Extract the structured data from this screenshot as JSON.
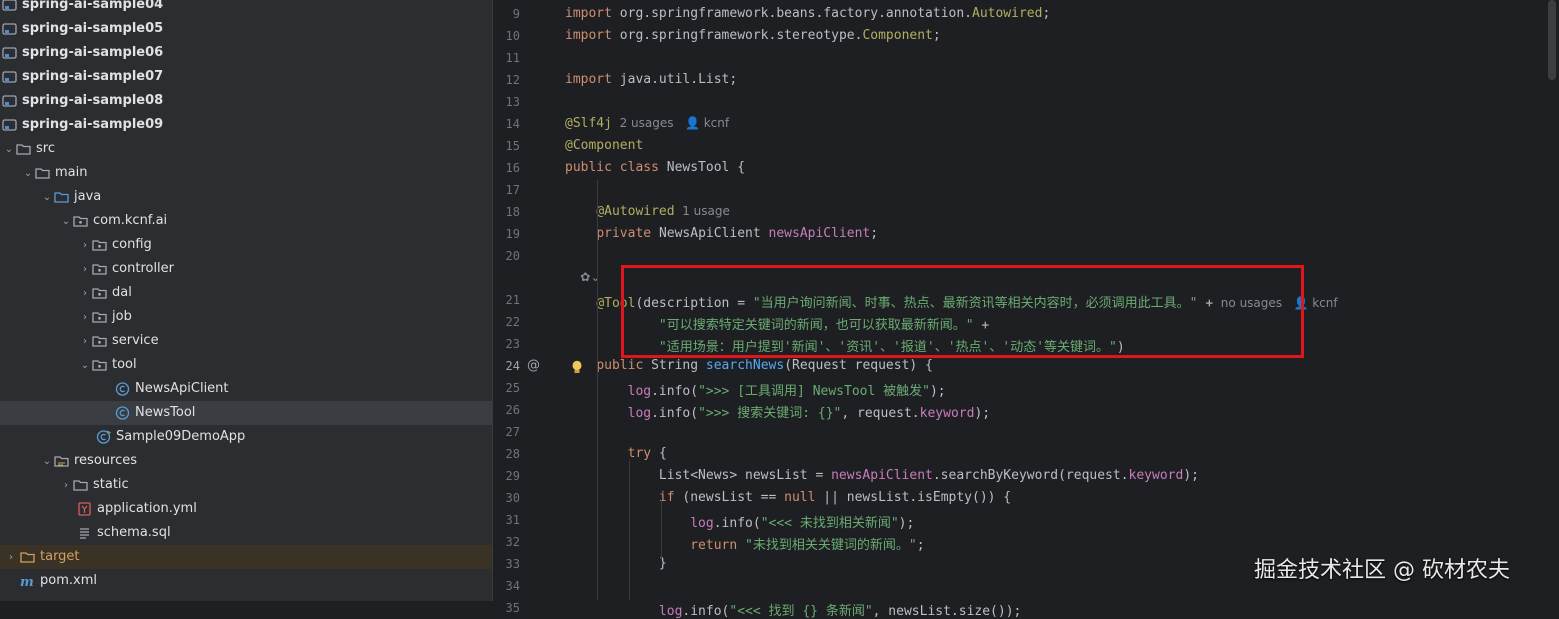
{
  "project_tree": {
    "rows": [
      {
        "label": "spring-ai-sample04",
        "kind": "module",
        "bold": true
      },
      {
        "label": "spring-ai-sample05",
        "kind": "module",
        "bold": true
      },
      {
        "label": "spring-ai-sample06",
        "kind": "module",
        "bold": true
      },
      {
        "label": "spring-ai-sample07",
        "kind": "module",
        "bold": true
      },
      {
        "label": "spring-ai-sample08",
        "kind": "module",
        "bold": true
      },
      {
        "label": "spring-ai-sample09",
        "kind": "module",
        "bold": true
      },
      {
        "label": "src",
        "kind": "folder",
        "indent": 0,
        "arrow": "down"
      },
      {
        "label": "main",
        "kind": "folder",
        "indent": 1,
        "arrow": "down"
      },
      {
        "label": "java",
        "kind": "folder-src",
        "indent": 2,
        "arrow": "down"
      },
      {
        "label": "com.kcnf.ai",
        "kind": "package",
        "indent": 3,
        "arrow": "down"
      },
      {
        "label": "config",
        "kind": "package",
        "indent": 4,
        "arrow": "right"
      },
      {
        "label": "controller",
        "kind": "package",
        "indent": 4,
        "arrow": "right"
      },
      {
        "label": "dal",
        "kind": "package",
        "indent": 4,
        "arrow": "right"
      },
      {
        "label": "job",
        "kind": "package",
        "indent": 4,
        "arrow": "right"
      },
      {
        "label": "service",
        "kind": "package",
        "indent": 4,
        "arrow": "right"
      },
      {
        "label": "tool",
        "kind": "package",
        "indent": 4,
        "arrow": "down"
      },
      {
        "label": "NewsApiClient",
        "kind": "class",
        "indent": 5
      },
      {
        "label": "NewsTool",
        "kind": "class",
        "indent": 5,
        "selected": true
      },
      {
        "label": "Sample09DemoApp",
        "kind": "class-app",
        "indent": 4
      },
      {
        "label": "resources",
        "kind": "folder-res",
        "indent": 2,
        "arrow": "down"
      },
      {
        "label": "static",
        "kind": "folder",
        "indent": 3,
        "arrow": "right"
      },
      {
        "label": "application.yml",
        "kind": "yaml",
        "indent": 3
      },
      {
        "label": "schema.sql",
        "kind": "sql",
        "indent": 3
      },
      {
        "label": "target",
        "kind": "folder-target",
        "indent": -1,
        "arrow": "right",
        "target": true
      },
      {
        "label": "pom.xml",
        "kind": "maven",
        "indent": -1
      }
    ]
  },
  "editor": {
    "current_line": 24,
    "lines": [
      {
        "n": 9,
        "spans": [
          [
            "kw",
            "import "
          ],
          [
            "",
            "org.springframework.beans.factory.annotation."
          ],
          [
            "ann",
            "Autowired"
          ],
          [
            "",
            ";"
          ]
        ]
      },
      {
        "n": 10,
        "spans": [
          [
            "kw",
            "import "
          ],
          [
            "",
            "org.springframework.stereotype."
          ],
          [
            "ann",
            "Component"
          ],
          [
            "",
            ";"
          ]
        ]
      },
      {
        "n": 11,
        "spans": []
      },
      {
        "n": 12,
        "spans": [
          [
            "kw",
            "import "
          ],
          [
            "",
            "java.util.List;"
          ]
        ]
      },
      {
        "n": 13,
        "spans": []
      },
      {
        "n": 14,
        "spans": [
          [
            "ann",
            "@Slf4j"
          ],
          [
            "inlay",
            "  2 usages   👤 kcnf"
          ]
        ]
      },
      {
        "n": 15,
        "spans": [
          [
            "ann",
            "@Component"
          ]
        ]
      },
      {
        "n": 16,
        "spans": [
          [
            "kw",
            "public class "
          ],
          [
            "",
            "NewsTool {"
          ]
        ]
      },
      {
        "n": 17,
        "spans": []
      },
      {
        "n": 18,
        "spans": [
          [
            "",
            "    "
          ],
          [
            "ann",
            "@Autowired"
          ],
          [
            "inlay",
            "  1 usage"
          ]
        ]
      },
      {
        "n": 19,
        "spans": [
          [
            "",
            "    "
          ],
          [
            "kw",
            "private "
          ],
          [
            "",
            "NewsApiClient "
          ],
          [
            "fld",
            "newsApiClient"
          ],
          [
            "",
            ";"
          ]
        ]
      },
      {
        "n": 20,
        "spans": []
      },
      {
        "n": null,
        "spans": [
          [
            "inlay",
            "    ✿⌄"
          ]
        ]
      },
      {
        "n": 21,
        "spans": [
          [
            "",
            "    "
          ],
          [
            "ann",
            "@Tool"
          ],
          [
            "",
            "(description = "
          ],
          [
            "str",
            "\"当用户询问新闻、时事、热点、最新资讯等相关内容时，必须调用此工具。\""
          ],
          [
            "",
            " +"
          ],
          [
            "inlay",
            "  no usages   👤 kcnf"
          ]
        ]
      },
      {
        "n": 22,
        "spans": [
          [
            "",
            "            "
          ],
          [
            "str",
            "\"可以搜索特定关键词的新闻，也可以获取最新新闻。\""
          ],
          [
            "",
            " +"
          ]
        ]
      },
      {
        "n": 23,
        "spans": [
          [
            "",
            "            "
          ],
          [
            "str",
            "\"适用场景：用户提到'新闻'、'资讯'、'报道'、'热点'、'动态'等关键词。\""
          ],
          [
            "",
            ")"
          ]
        ]
      },
      {
        "n": 24,
        "spans": [
          [
            "",
            "    "
          ],
          [
            "kw",
            "public "
          ],
          [
            "",
            "String "
          ],
          [
            "mth",
            "searchNews"
          ],
          [
            "",
            "(Request request) {"
          ]
        ]
      },
      {
        "n": 25,
        "spans": [
          [
            "",
            "        "
          ],
          [
            "fld",
            "log"
          ],
          [
            "",
            ".info("
          ],
          [
            "str",
            "\">>> [工具调用] NewsTool 被触发\""
          ],
          [
            "",
            ");"
          ]
        ]
      },
      {
        "n": 26,
        "spans": [
          [
            "",
            "        "
          ],
          [
            "fld",
            "log"
          ],
          [
            "",
            ".info("
          ],
          [
            "str",
            "\">>> 搜索关键词: {}\""
          ],
          [
            "",
            ", request."
          ],
          [
            "fld",
            "keyword"
          ],
          [
            "",
            ");"
          ]
        ]
      },
      {
        "n": 27,
        "spans": []
      },
      {
        "n": 28,
        "spans": [
          [
            "",
            "        "
          ],
          [
            "kw",
            "try "
          ],
          [
            "",
            "{"
          ]
        ]
      },
      {
        "n": 29,
        "spans": [
          [
            "",
            "            List<News> newsList = "
          ],
          [
            "fld",
            "newsApiClient"
          ],
          [
            "",
            ".searchByKeyword(request."
          ],
          [
            "fld",
            "keyword"
          ],
          [
            "",
            ");"
          ]
        ]
      },
      {
        "n": 30,
        "spans": [
          [
            "",
            "            "
          ],
          [
            "kw",
            "if "
          ],
          [
            "",
            "(newsList == "
          ],
          [
            "kw",
            "null "
          ],
          [
            "",
            "|| newsList.isEmpty()) {"
          ]
        ]
      },
      {
        "n": 31,
        "spans": [
          [
            "",
            "                "
          ],
          [
            "fld",
            "log"
          ],
          [
            "",
            ".info("
          ],
          [
            "str",
            "\"<<< 未找到相关新闻\""
          ],
          [
            "",
            ");"
          ]
        ]
      },
      {
        "n": 32,
        "spans": [
          [
            "",
            "                "
          ],
          [
            "kw",
            "return "
          ],
          [
            "str",
            "\"未找到相关关键词的新闻。\""
          ],
          [
            "",
            ";"
          ]
        ]
      },
      {
        "n": 33,
        "spans": [
          [
            "",
            "            }"
          ]
        ]
      },
      {
        "n": 34,
        "spans": []
      },
      {
        "n": 35,
        "spans": [
          [
            "",
            "            "
          ],
          [
            "fld",
            "log"
          ],
          [
            "",
            ".info("
          ],
          [
            "str",
            "\"<<< 找到 {} 条新闻\""
          ],
          [
            "",
            ", newsList.size());"
          ]
        ]
      }
    ]
  },
  "watermark": "掘金技术社区 @ 砍材农夫"
}
